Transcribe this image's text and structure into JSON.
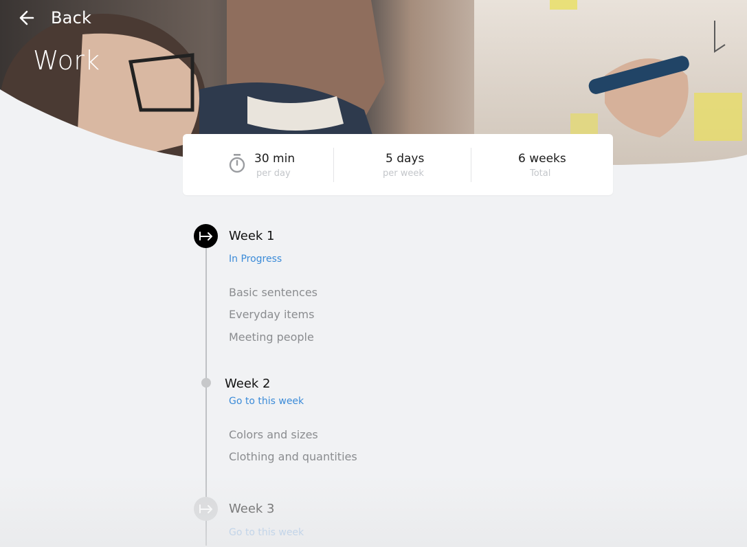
{
  "header": {
    "back_label": "Back",
    "title": "Work"
  },
  "stats": [
    {
      "value": "30 min",
      "label": "per day"
    },
    {
      "value": "5 days",
      "label": "per week"
    },
    {
      "value": "6 weeks",
      "label": "Total"
    }
  ],
  "weeks": [
    {
      "title": "Week 1",
      "status": "In Progress",
      "lessons": [
        "Basic sentences",
        "Everyday items",
        "Meeting people"
      ]
    },
    {
      "title": "Week 2",
      "status": "Go to this week",
      "lessons": [
        "Colors and sizes",
        "Clothing and quantities"
      ]
    },
    {
      "title": "Week 3",
      "status": "Go to this week",
      "lessons": []
    }
  ],
  "colors": {
    "background": "#f1f2f4",
    "link": "#3b8bd8",
    "active_node": "#000000"
  }
}
